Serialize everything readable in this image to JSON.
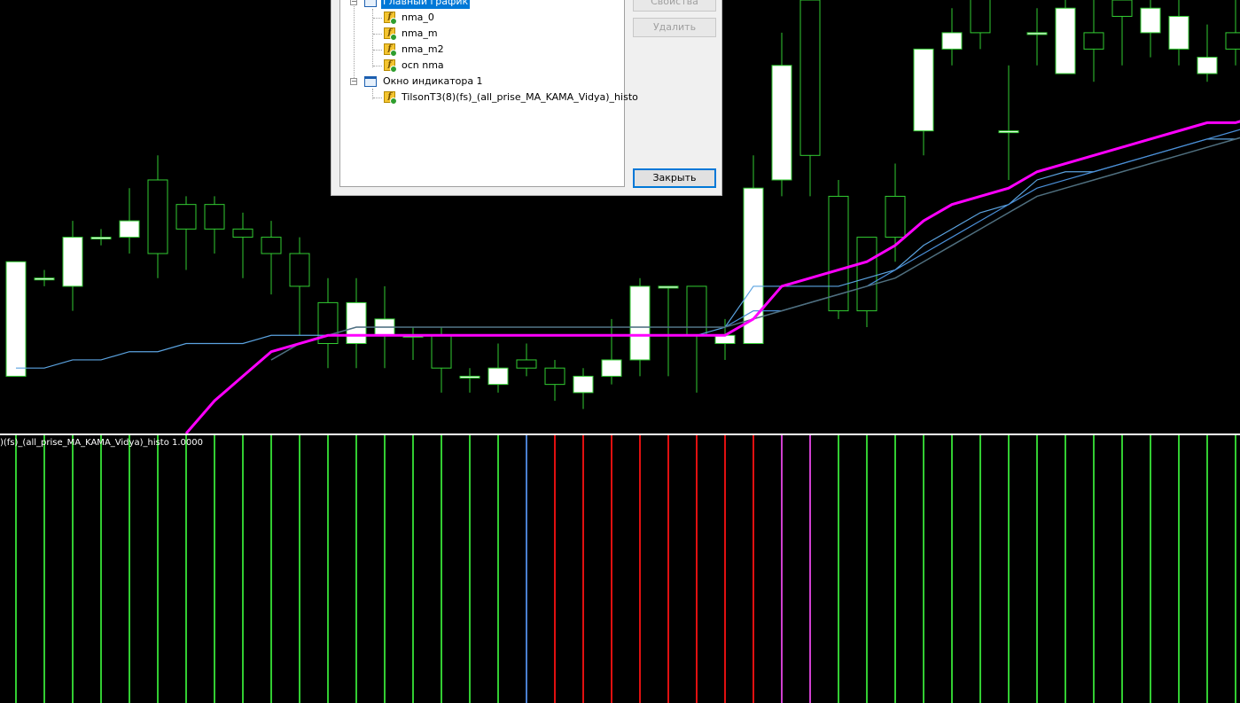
{
  "colors": {
    "background": "#000000",
    "candle_body_up": "#ffffff",
    "candle_outline": "#32cd32",
    "wick": "#32cd32",
    "ma_magenta": "#ff00ff",
    "ma_blue": "#4a8fd8",
    "ma_lightblue": "#5ba3e0",
    "ma_gray": "#4f6f7f",
    "histo_green": "#32cd32",
    "histo_red": "#e01010",
    "histo_blue": "#4a7fd0",
    "histo_magenta": "#d040d0",
    "separator": "#ffffff"
  },
  "subwindow": {
    "label": ")(fs)_(all_prise_MA_KAMA_Vidya)_histo 1.0000",
    "histo_colors": [
      "g",
      "g",
      "g",
      "g",
      "g",
      "g",
      "g",
      "g",
      "g",
      "g",
      "g",
      "g",
      "g",
      "g",
      "g",
      "g",
      "g",
      "g",
      "b",
      "r",
      "r",
      "r",
      "r",
      "r",
      "r",
      "r",
      "r",
      "m",
      "m",
      "g",
      "g",
      "g",
      "g",
      "g",
      "g",
      "g",
      "g",
      "g",
      "g",
      "g",
      "g",
      "g",
      "g",
      "g",
      "g"
    ]
  },
  "dialog": {
    "tree": [
      {
        "label": "Главный график",
        "level": 0,
        "icon": "window-icon",
        "selected": true
      },
      {
        "label": "nma_0",
        "level": 1,
        "icon": "indicator-icon"
      },
      {
        "label": "nma_m",
        "level": 1,
        "icon": "indicator-icon"
      },
      {
        "label": "nma_m2",
        "level": 1,
        "icon": "indicator-icon"
      },
      {
        "label": "ocn nma",
        "level": 1,
        "icon": "indicator-icon"
      },
      {
        "label": "Окно индикатора 1",
        "level": 0,
        "icon": "window-icon"
      },
      {
        "label": "TilsonT3(8)(fs)_(all_prise_MA_KAMA_Vidya)_histo",
        "level": 1,
        "icon": "indicator-icon"
      }
    ],
    "buttons": {
      "properties": "Свойства",
      "delete": "Удалить",
      "close": "Закрыть"
    }
  },
  "chart_data": {
    "type": "candlestick",
    "candles": [
      [
        0.548,
        0.562,
        0.558,
        0.56
      ],
      [
        0.56,
        0.56,
        0.559,
        0.561
      ],
      [
        0.559,
        0.565,
        0.556,
        0.567
      ],
      [
        0.565,
        0.565,
        0.564,
        0.566
      ],
      [
        0.565,
        0.567,
        0.563,
        0.571
      ],
      [
        0.572,
        0.563,
        0.56,
        0.575
      ],
      [
        0.569,
        0.566,
        0.561,
        0.57
      ],
      [
        0.569,
        0.566,
        0.563,
        0.57
      ],
      [
        0.566,
        0.565,
        0.56,
        0.568
      ],
      [
        0.565,
        0.563,
        0.558,
        0.567
      ],
      [
        0.563,
        0.559,
        0.553,
        0.565
      ],
      [
        0.557,
        0.552,
        0.549,
        0.56
      ],
      [
        0.552,
        0.557,
        0.549,
        0.56
      ],
      [
        0.553,
        0.555,
        0.549,
        0.559
      ],
      [
        0.553,
        0.553,
        0.55,
        0.554
      ],
      [
        0.553,
        0.549,
        0.546,
        0.554
      ],
      [
        0.548,
        0.548,
        0.546,
        0.549
      ],
      [
        0.547,
        0.549,
        0.546,
        0.552
      ],
      [
        0.55,
        0.549,
        0.548,
        0.552
      ],
      [
        0.549,
        0.547,
        0.545,
        0.55
      ],
      [
        0.546,
        0.548,
        0.544,
        0.549
      ],
      [
        0.548,
        0.55,
        0.547,
        0.555
      ],
      [
        0.55,
        0.559,
        0.548,
        0.56
      ],
      [
        0.559,
        0.559,
        0.548,
        0.559
      ],
      [
        0.559,
        0.553,
        0.546,
        0.559
      ],
      [
        0.552,
        0.553,
        0.55,
        0.555
      ],
      [
        0.552,
        0.571,
        0.552,
        0.575
      ],
      [
        0.572,
        0.586,
        0.57,
        0.59
      ],
      [
        0.594,
        0.575,
        0.57,
        0.594
      ],
      [
        0.57,
        0.556,
        0.555,
        0.572
      ],
      [
        0.565,
        0.556,
        0.554,
        0.565
      ],
      [
        0.57,
        0.565,
        0.562,
        0.574
      ],
      [
        0.578,
        0.588,
        0.575,
        0.588
      ],
      [
        0.588,
        0.59,
        0.586,
        0.593
      ],
      [
        0.595,
        0.59,
        0.588,
        0.595
      ],
      [
        0.578,
        0.578,
        0.572,
        0.586
      ],
      [
        0.59,
        0.59,
        0.586,
        0.593
      ],
      [
        0.585,
        0.593,
        0.585,
        0.596
      ],
      [
        0.59,
        0.588,
        0.584,
        0.594
      ],
      [
        0.594,
        0.592,
        0.586,
        0.596
      ],
      [
        0.59,
        0.593,
        0.587,
        0.596
      ],
      [
        0.588,
        0.592,
        0.586,
        0.596
      ],
      [
        0.585,
        0.587,
        0.584,
        0.591
      ],
      [
        0.59,
        0.588,
        0.586,
        0.594
      ]
    ],
    "ylim": [
      0.541,
      0.594
    ],
    "series": [
      {
        "color": "ma_lightblue",
        "values": [
          0.549,
          0.549,
          0.55,
          0.55,
          0.551,
          0.551,
          0.552,
          0.552,
          0.552,
          0.553,
          0.553,
          0.553,
          0.553,
          0.553,
          0.553,
          0.553,
          0.553,
          0.553,
          0.553,
          0.553,
          0.553,
          0.553,
          0.553,
          0.553,
          0.553,
          0.554,
          0.559,
          0.559,
          0.559,
          0.559,
          0.56,
          0.561,
          0.564,
          0.566,
          0.568,
          0.569,
          0.572,
          0.573,
          0.573,
          0.574,
          0.575,
          0.576,
          0.577,
          0.577,
          0.578
        ]
      },
      {
        "color": "ma_blue",
        "values": [
          null,
          null,
          null,
          null,
          null,
          null,
          null,
          null,
          null,
          0.55,
          0.552,
          0.553,
          0.554,
          0.554,
          0.554,
          0.554,
          0.554,
          0.554,
          0.554,
          0.554,
          0.554,
          0.554,
          0.554,
          0.554,
          0.554,
          0.554,
          0.556,
          0.556,
          0.557,
          0.558,
          0.559,
          0.561,
          0.563,
          0.565,
          0.567,
          0.569,
          0.571,
          0.572,
          0.573,
          0.574,
          0.575,
          0.576,
          0.577,
          0.578,
          0.579
        ]
      },
      {
        "color": "ma_gray",
        "values": [
          null,
          null,
          null,
          null,
          null,
          null,
          null,
          null,
          null,
          0.55,
          0.552,
          0.553,
          0.554,
          0.554,
          0.554,
          0.554,
          0.554,
          0.554,
          0.554,
          0.554,
          0.554,
          0.554,
          0.554,
          0.554,
          0.554,
          0.554,
          0.555,
          0.556,
          0.557,
          0.558,
          0.559,
          0.56,
          0.562,
          0.564,
          0.566,
          0.568,
          0.57,
          0.571,
          0.572,
          0.573,
          0.574,
          0.575,
          0.576,
          0.577,
          0.578
        ]
      },
      {
        "color": "ma_magenta",
        "values": [
          null,
          null,
          null,
          null,
          null,
          null,
          0.541,
          0.545,
          0.548,
          0.551,
          0.552,
          0.553,
          0.553,
          0.553,
          0.553,
          0.553,
          0.553,
          0.553,
          0.553,
          0.553,
          0.553,
          0.553,
          0.553,
          0.553,
          0.553,
          0.553,
          0.555,
          0.559,
          0.56,
          0.561,
          0.562,
          0.564,
          0.567,
          0.569,
          0.57,
          0.571,
          0.573,
          0.574,
          0.575,
          0.576,
          0.577,
          0.578,
          0.579,
          0.579,
          0.58
        ]
      }
    ]
  }
}
